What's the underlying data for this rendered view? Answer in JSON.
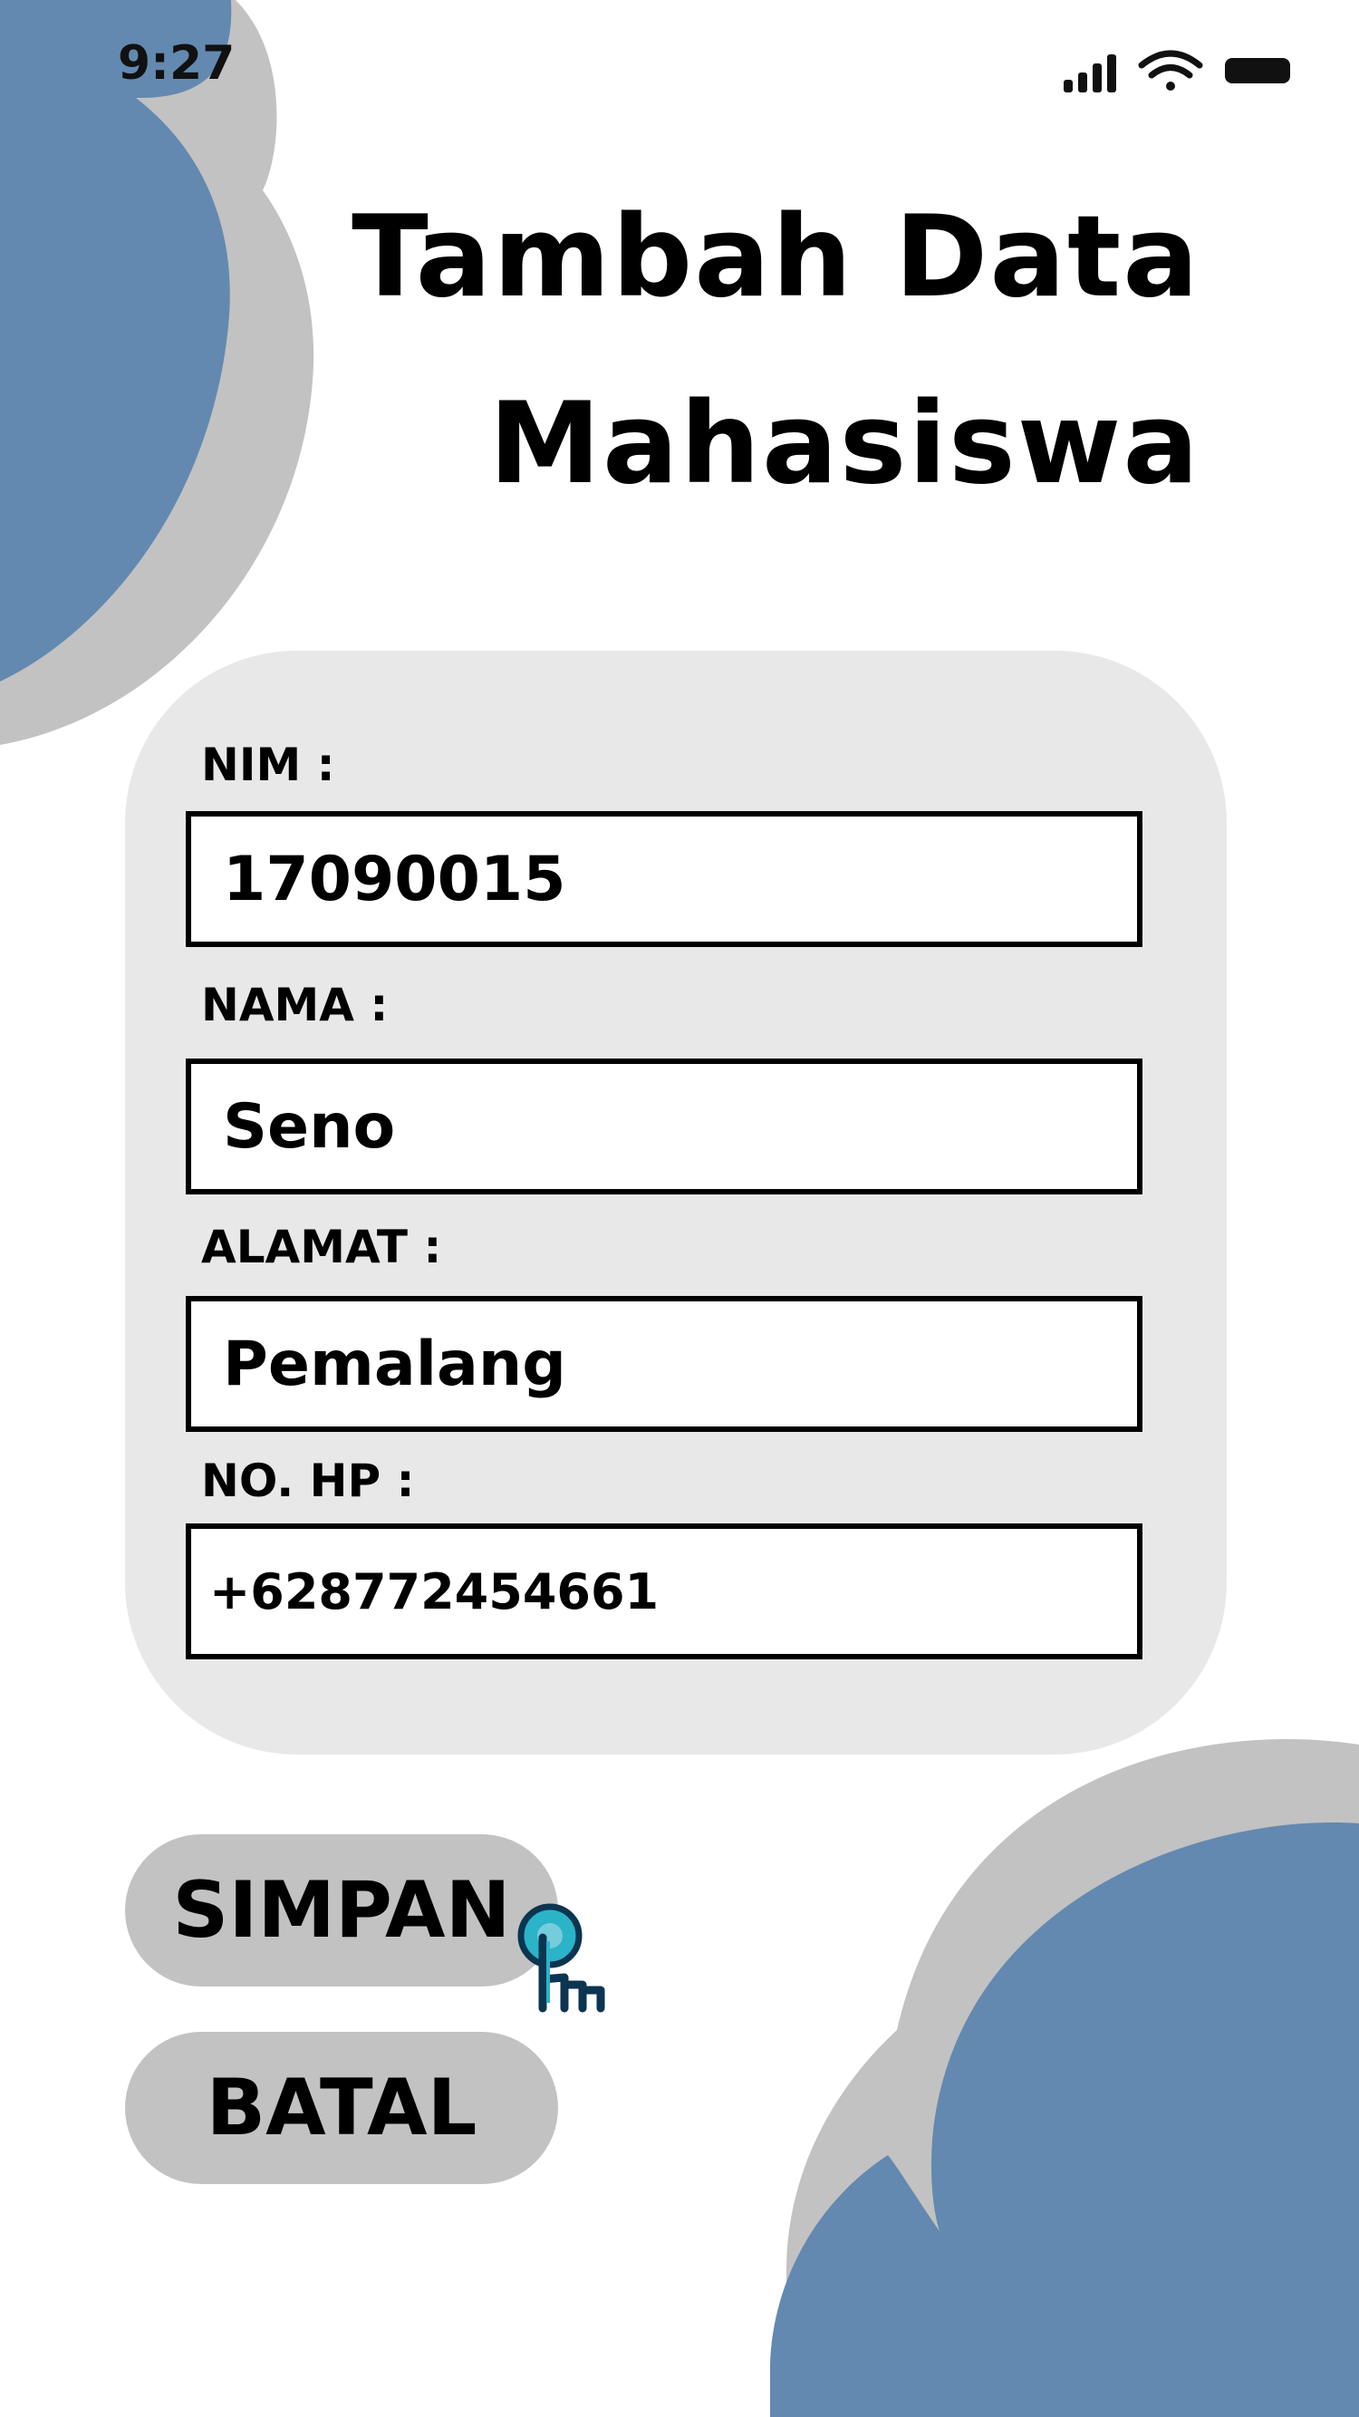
{
  "status_bar": {
    "time": "9:27"
  },
  "title": {
    "line1": "Tambah Data",
    "line2": "Mahasiswa"
  },
  "form": {
    "nim": {
      "label": "NIM :",
      "value": "17090015"
    },
    "nama": {
      "label": "NAMA :",
      "value": "Seno"
    },
    "alamat": {
      "label": "ALAMAT :",
      "value": "Pemalang"
    },
    "no_hp": {
      "label": "NO. HP :",
      "value": "+628772454661"
    }
  },
  "buttons": {
    "save_label": "SIMPAN",
    "cancel_label": "BATAL"
  },
  "icons": [
    "signal-icon",
    "wifi-icon",
    "battery-icon",
    "hand-pointer-icon"
  ],
  "colors": {
    "blue": "#6389b0",
    "grey": "#c2c2c2",
    "card": "#e8e8e8"
  }
}
